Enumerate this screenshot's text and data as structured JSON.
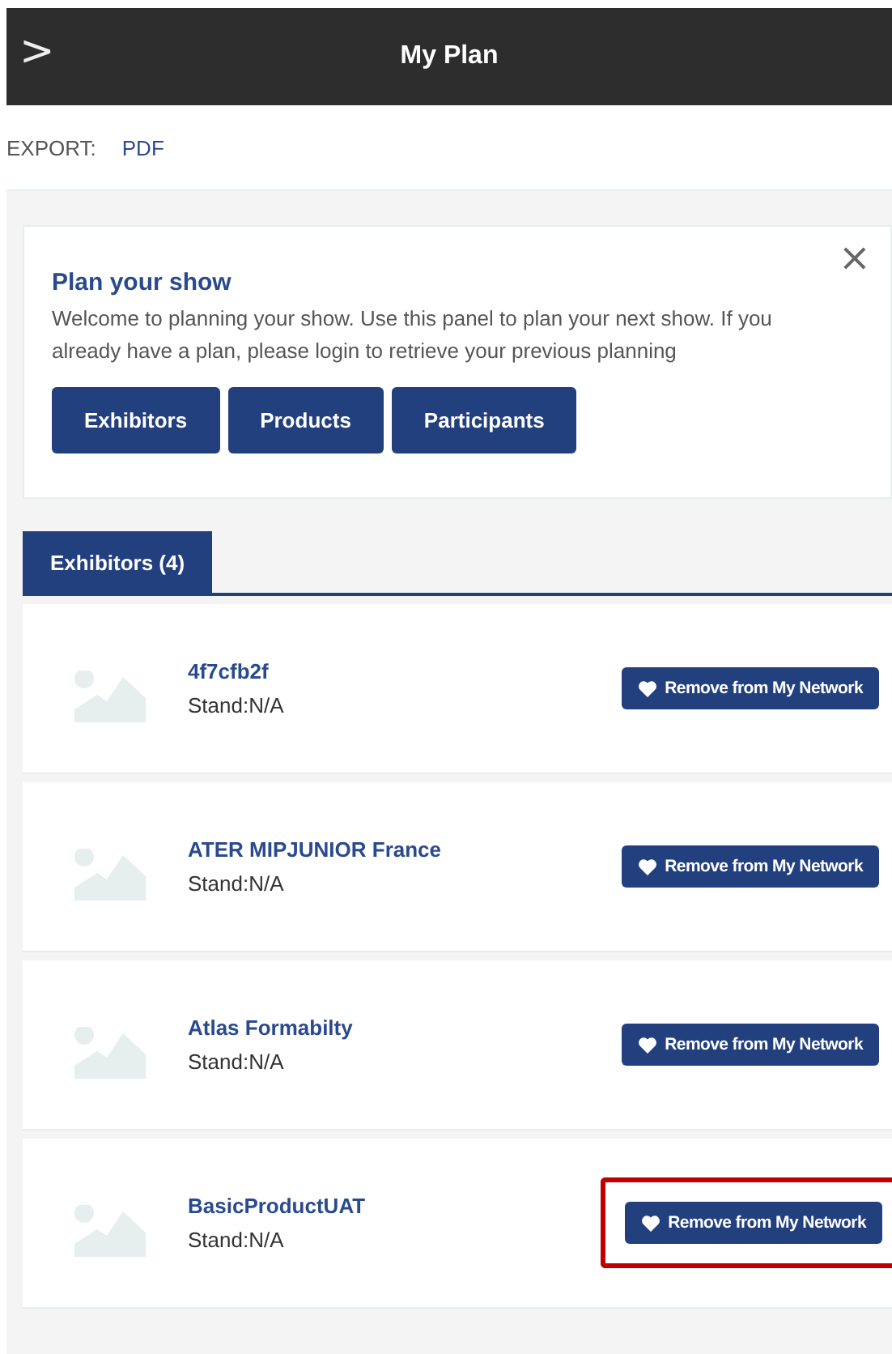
{
  "header": {
    "title": "My Plan",
    "back_glyph": ">"
  },
  "export": {
    "label": "EXPORT:",
    "link": "PDF"
  },
  "panel": {
    "title": "Plan your show",
    "text": "Welcome to planning your show. Use this panel to plan your next show. If you already have a plan, please login to retrieve your previous planning",
    "close": "×",
    "buttons": [
      "Exhibitors",
      "Products",
      "Participants"
    ]
  },
  "tabs": [
    {
      "label": "Exhibitors (4)",
      "selected": true
    }
  ],
  "exhibitors": [
    {
      "name": "4f7cfb2f",
      "stand": "Stand:N/A",
      "button": "Remove from My Network",
      "highlighted": false
    },
    {
      "name": "ATER MIPJUNIOR France",
      "stand": "Stand:N/A",
      "button": "Remove from My Network",
      "highlighted": false
    },
    {
      "name": "Atlas Formabilty",
      "stand": "Stand:N/A",
      "button": "Remove from My Network",
      "highlighted": false
    },
    {
      "name": "BasicProductUAT",
      "stand": "Stand:N/A",
      "button": "Remove from My Network",
      "highlighted": true
    }
  ]
}
